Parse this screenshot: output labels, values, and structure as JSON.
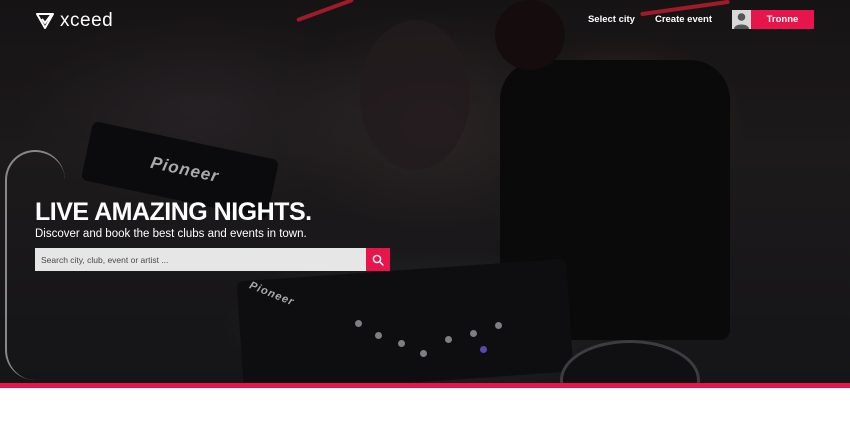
{
  "brand": {
    "name": "xceed",
    "accent": "#e8154d"
  },
  "nav": {
    "select_city": "Select city",
    "create_event": "Create event",
    "user_name": "Tronne"
  },
  "hero": {
    "headline": "LIVE AMAZING NIGHTS.",
    "subline": "Discover and book the best clubs and events in town."
  },
  "search": {
    "placeholder": "Search city, club, event or artist ...",
    "value": "",
    "button_icon": "search-icon"
  },
  "scene": {
    "deck_brand": "Pioneer"
  }
}
